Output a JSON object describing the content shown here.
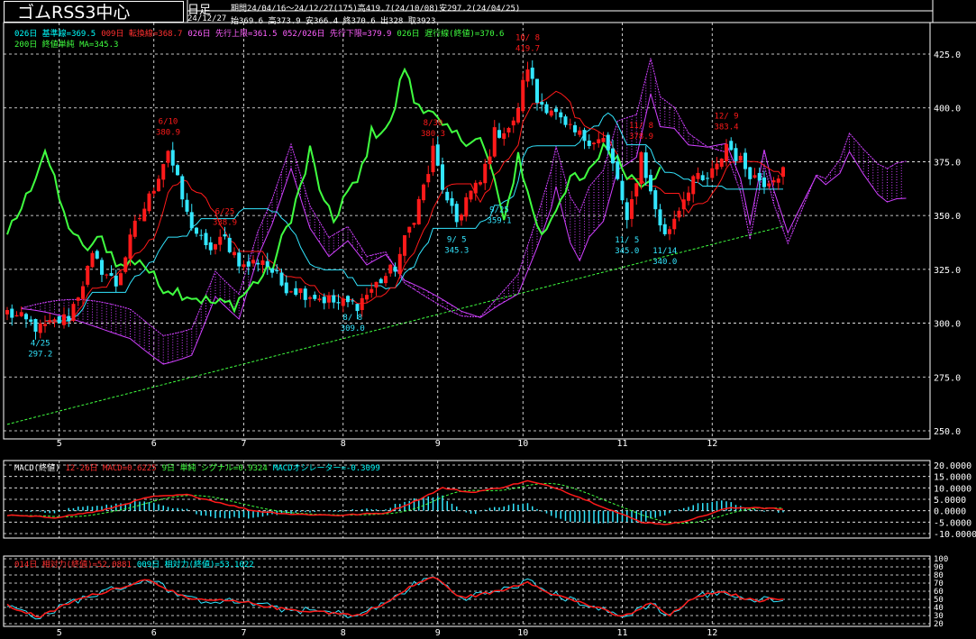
{
  "header": {
    "title": "ゴムRSS3中心",
    "timeframe": "日足",
    "period": "期間24/04/16～24/12/27(175)高419.7(24/10/08)安297.2(24/04/25)",
    "date": "24/12/27",
    "ohlc": "始369.6 高373.9 安366.4 終370.6 出328 取3923"
  },
  "legends": {
    "main_line1": [
      {
        "text": "026日 基準線=369.5",
        "color": "#00ffff"
      },
      {
        "text": "009日 転換線=368.7",
        "color": "#ff3030"
      },
      {
        "text": "026日 先行上限=361.5",
        "color": "#ff60ff"
      },
      {
        "text": "052/026日 先行下限=379.9",
        "color": "#ff60ff"
      },
      {
        "text": "026日 遅行線(終値)=370.6",
        "color": "#40ff40"
      }
    ],
    "main_line2": [
      {
        "text": "200日 終値単純 MA=345.3",
        "color": "#40ff40"
      }
    ],
    "macd": [
      {
        "text": "MACD(終値)",
        "color": "#ffffff"
      },
      {
        "text": "12-26日 MACD=0.6225",
        "color": "#ff3030"
      },
      {
        "text": "9日 単純 シグナル=0.9324",
        "color": "#40ff40"
      },
      {
        "text": "MACDオシレーター=-0.3099",
        "color": "#00ffff"
      }
    ],
    "rsi": [
      {
        "text": "014日 相対力(終値)=52.0881",
        "color": "#ff3030"
      },
      {
        "text": "009日 相対力(終値)=53.1022",
        "color": "#00ffff"
      }
    ]
  },
  "colors": {
    "up": "#ff1a1a",
    "down": "#33e6ff",
    "green": "#40ff40",
    "magenta": "#d040ff",
    "grid": "#ffffff",
    "text": "#ffffff"
  },
  "chart_data": [
    {
      "type": "candlestick",
      "ylim": [
        250,
        425
      ],
      "yticks": [
        "425.0",
        "400.0",
        "375.0",
        "350.0",
        "325.0",
        "300.0",
        "275.0",
        "250.0"
      ],
      "months": [
        {
          "label": "5",
          "index": 11
        },
        {
          "label": "6",
          "index": 31
        },
        {
          "label": "7",
          "index": 50
        },
        {
          "label": "8",
          "index": 71
        },
        {
          "label": "9",
          "index": 91
        },
        {
          "label": "10",
          "index": 109
        },
        {
          "label": "11",
          "index": 130
        },
        {
          "label": "12",
          "index": 149
        }
      ],
      "keypoints": [
        [
          0,
          305
        ],
        [
          7,
          297.2
        ],
        [
          13,
          303
        ],
        [
          18,
          330
        ],
        [
          23,
          318
        ],
        [
          27,
          345
        ],
        [
          30,
          358
        ],
        [
          34,
          380.9
        ],
        [
          38,
          350
        ],
        [
          42,
          334
        ],
        [
          46,
          338.9
        ],
        [
          50,
          326
        ],
        [
          54,
          330
        ],
        [
          58,
          318
        ],
        [
          62,
          315
        ],
        [
          66,
          312
        ],
        [
          70,
          309
        ],
        [
          74,
          309
        ],
        [
          78,
          318
        ],
        [
          82,
          326
        ],
        [
          86,
          350
        ],
        [
          89,
          370
        ],
        [
          90,
          380.3
        ],
        [
          93,
          355
        ],
        [
          95,
          347
        ],
        [
          97,
          358
        ],
        [
          100,
          365
        ],
        [
          103,
          388
        ],
        [
          107,
          392
        ],
        [
          110,
          419.7
        ],
        [
          112,
          403
        ],
        [
          115,
          400
        ],
        [
          118,
          390
        ],
        [
          122,
          386
        ],
        [
          126,
          385
        ],
        [
          129,
          367
        ],
        [
          131,
          345
        ],
        [
          134,
          378.9
        ],
        [
          136,
          360
        ],
        [
          139,
          340
        ],
        [
          142,
          354
        ],
        [
          145,
          368
        ],
        [
          147,
          365
        ],
        [
          150,
          372
        ],
        [
          152,
          383.4
        ],
        [
          155,
          375
        ],
        [
          158,
          368
        ],
        [
          160,
          366
        ],
        [
          162,
          369
        ],
        [
          164,
          370.6
        ]
      ],
      "annotations": [
        {
          "type": "high",
          "date": "6/10",
          "value": "380.9",
          "index": 34,
          "price": 380.9
        },
        {
          "type": "high",
          "date": "6/25",
          "value": "338.9",
          "index": 46,
          "price": 338.9
        },
        {
          "type": "high",
          "date": "8/30",
          "value": "380.3",
          "index": 90,
          "price": 380.3
        },
        {
          "type": "high",
          "date": "10/ 8",
          "value": "419.7",
          "index": 110,
          "price": 419.7
        },
        {
          "type": "high",
          "date": "11/ 8",
          "value": "378.9",
          "index": 134,
          "price": 378.9
        },
        {
          "type": "high",
          "date": "12/ 9",
          "value": "383.4",
          "index": 152,
          "price": 383.4
        },
        {
          "type": "low",
          "date": "4/25",
          "value": "297.2",
          "index": 7,
          "price": 297.2
        },
        {
          "type": "low",
          "date": "8/ 8",
          "value": "309.0",
          "index": 73,
          "price": 309.0
        },
        {
          "type": "low",
          "date": "9/ 5",
          "value": "345.3",
          "index": 95,
          "price": 345.3
        },
        {
          "type": "low",
          "date": "9/25",
          "value": "359.1",
          "index": 104,
          "price": 359.1
        },
        {
          "type": "low",
          "date": "11/ 5",
          "value": "345.0",
          "index": 131,
          "price": 345.0
        },
        {
          "type": "low",
          "date": "11/14",
          "value": "340.0",
          "index": 139,
          "price": 340.0
        }
      ]
    },
    {
      "type": "line",
      "title": "MACD(終値)",
      "ylim": [
        -10,
        20
      ],
      "yticks": [
        "20.0000",
        "15.0000",
        "10.0000",
        "5.0000",
        "0.0000",
        "-5.0000",
        "-10.0000"
      ],
      "series": [
        {
          "name": "MACD",
          "key": "macd"
        },
        {
          "name": "シグナル",
          "key": "signal"
        },
        {
          "name": "MACDオシレーター",
          "key": "osc"
        }
      ],
      "keypoints": [
        [
          0,
          -2
        ],
        [
          10,
          -3
        ],
        [
          20,
          0
        ],
        [
          30,
          6
        ],
        [
          38,
          7
        ],
        [
          46,
          3
        ],
        [
          52,
          0
        ],
        [
          60,
          -1.5
        ],
        [
          70,
          -2
        ],
        [
          80,
          -1
        ],
        [
          86,
          4
        ],
        [
          92,
          10
        ],
        [
          98,
          8
        ],
        [
          104,
          10
        ],
        [
          110,
          13
        ],
        [
          116,
          10
        ],
        [
          122,
          5
        ],
        [
          128,
          0
        ],
        [
          134,
          -5
        ],
        [
          140,
          -6
        ],
        [
          146,
          -3
        ],
        [
          152,
          1
        ],
        [
          158,
          1.5
        ],
        [
          164,
          0.6
        ]
      ]
    },
    {
      "type": "line",
      "title": "相対力(終値)",
      "ylim": [
        20,
        100
      ],
      "yticks": [
        "100",
        "90",
        "80",
        "70",
        "60",
        "50",
        "40",
        "30",
        "20"
      ],
      "series": [
        {
          "name": "014日 相対力",
          "key": "rsi14"
        },
        {
          "name": "009日 相対力",
          "key": "rsi9"
        }
      ],
      "keypoints": [
        [
          0,
          42
        ],
        [
          7,
          28
        ],
        [
          14,
          48
        ],
        [
          22,
          62
        ],
        [
          30,
          75
        ],
        [
          38,
          50
        ],
        [
          46,
          48
        ],
        [
          52,
          45
        ],
        [
          58,
          38
        ],
        [
          66,
          35
        ],
        [
          74,
          30
        ],
        [
          80,
          45
        ],
        [
          86,
          68
        ],
        [
          90,
          78
        ],
        [
          96,
          52
        ],
        [
          104,
          60
        ],
        [
          110,
          72
        ],
        [
          116,
          55
        ],
        [
          122,
          45
        ],
        [
          130,
          28
        ],
        [
          136,
          45
        ],
        [
          140,
          30
        ],
        [
          146,
          55
        ],
        [
          152,
          58
        ],
        [
          158,
          48
        ],
        [
          164,
          52
        ]
      ]
    }
  ]
}
